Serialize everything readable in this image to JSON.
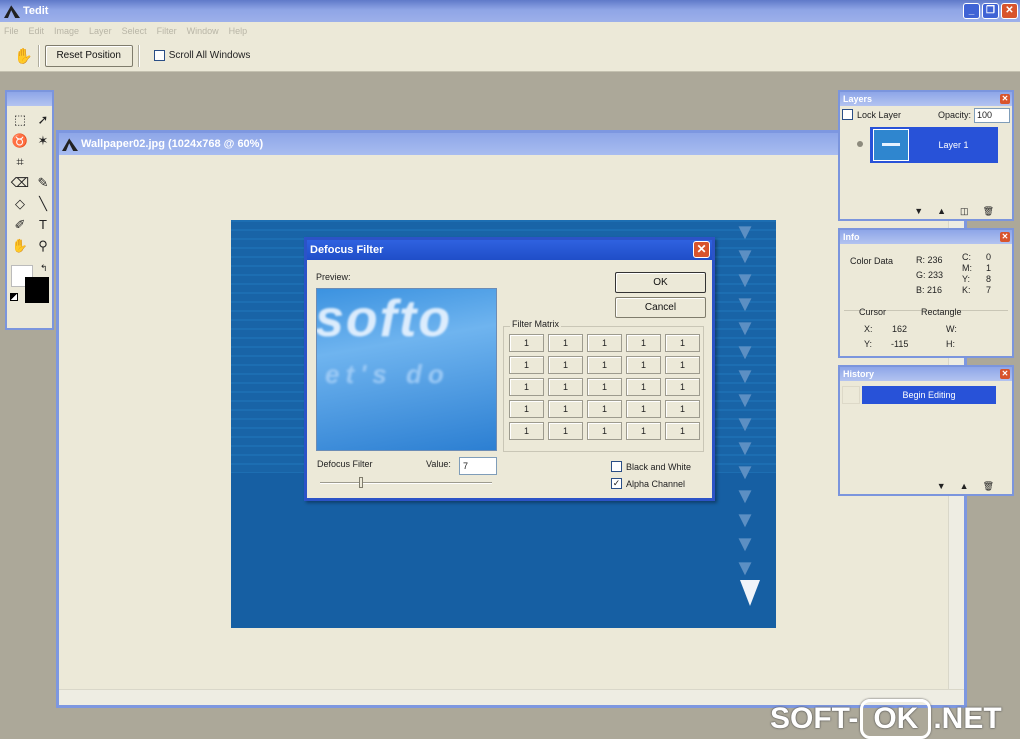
{
  "app": {
    "title": "Tedit"
  },
  "menu": [
    "File",
    "Edit",
    "Image",
    "Layer",
    "Select",
    "Filter",
    "Window",
    "Help"
  ],
  "toolbar": {
    "reset_label": "Reset Position",
    "scroll_all_label": "Scroll All Windows",
    "scroll_all_checked": false
  },
  "tools": [
    "marquee-icon",
    "move-icon",
    "lasso-icon",
    "magic-wand-icon",
    "crop-icon",
    "eraser-icon",
    "pencil-icon",
    "fill-bucket-icon",
    "line-icon",
    "eyedropper-icon",
    "text-icon",
    "hand-icon",
    "zoom-icon"
  ],
  "document": {
    "title": "Wallpaper02.jpg (1024x768 @ 60%)"
  },
  "dialog": {
    "title": "Defocus Filter",
    "preview_label": "Preview:",
    "preview_text_large": "softo",
    "preview_text_small": "et's do",
    "filter_label": "Defocus Filter",
    "value_label": "Value:",
    "value": "7",
    "ok_label": "OK",
    "cancel_label": "Cancel",
    "matrix_label": "Filter Matrix",
    "matrix": [
      [
        "1",
        "1",
        "1",
        "1",
        "1"
      ],
      [
        "1",
        "1",
        "1",
        "1",
        "1"
      ],
      [
        "1",
        "1",
        "1",
        "1",
        "1"
      ],
      [
        "1",
        "1",
        "1",
        "1",
        "1"
      ],
      [
        "1",
        "1",
        "1",
        "1",
        "1"
      ]
    ],
    "bw_label": "Black and White",
    "bw_checked": false,
    "alpha_label": "Alpha Channel",
    "alpha_checked": true
  },
  "layers": {
    "title": "Layers",
    "lock_label": "Lock Layer",
    "opacity_label": "Opacity:",
    "opacity_value": "100",
    "layer_name": "Layer 1"
  },
  "info": {
    "title": "Info",
    "color_data_label": "Color Data",
    "r": "R: 236",
    "g": "G: 233",
    "b": "B: 216",
    "c": "C:",
    "c_val": "0",
    "m": "M:",
    "m_val": "1",
    "y": "Y:",
    "y_val": "8",
    "k": "K:",
    "k_val": "7",
    "cursor_label": "Cursor",
    "rect_label": "Rectangle",
    "x_label": "X:",
    "x_val": "162",
    "y_label": "Y:",
    "y_pos": "-115",
    "w_label": "W:",
    "h_label": "H:"
  },
  "history": {
    "title": "History",
    "item": "Begin Editing"
  },
  "watermark": {
    "left": "SOFT-",
    "box": "OK",
    "right": ".NET"
  }
}
